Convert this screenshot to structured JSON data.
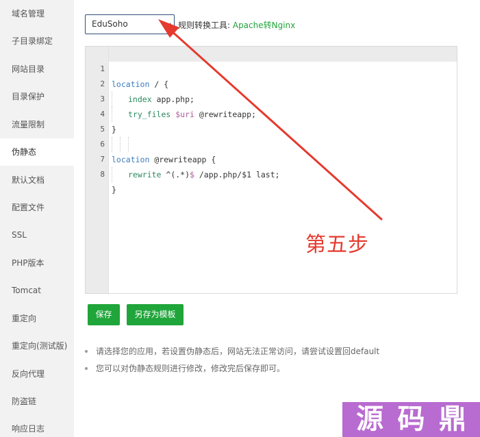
{
  "sidebar": {
    "items": [
      {
        "label": "域名管理"
      },
      {
        "label": "子目录绑定"
      },
      {
        "label": "网站目录"
      },
      {
        "label": "目录保护"
      },
      {
        "label": "流量限制"
      },
      {
        "label": "伪静态"
      },
      {
        "label": "默认文档"
      },
      {
        "label": "配置文件"
      },
      {
        "label": "SSL"
      },
      {
        "label": "PHP版本"
      },
      {
        "label": "Tomcat"
      },
      {
        "label": "重定向"
      },
      {
        "label": "重定向(测试版)"
      },
      {
        "label": "反向代理"
      },
      {
        "label": "防盗链"
      },
      {
        "label": "响应日志"
      }
    ],
    "active": "伪静态"
  },
  "preset": {
    "selected": "EduSoho"
  },
  "converter": {
    "label": "规则转换工具: ",
    "link": "Apache转Nginx"
  },
  "editor": {
    "line_numbers": [
      "1",
      "2",
      "3",
      "4",
      "5",
      "6",
      "7",
      "8"
    ],
    "lines": [
      "location / {",
      "    index app.php;",
      "    try_files $uri @rewriteapp;",
      "}",
      "",
      "location @rewriteapp {",
      "    rewrite ^(.*)$ /app.php/$1 last;",
      "}"
    ]
  },
  "buttons": {
    "save": "保存",
    "save_as_template": "另存为模板"
  },
  "tips": [
    "请选择您的应用，若设置伪静态后，网站无法正常访问，请尝试设置回default",
    "您可以对伪静态规则进行修改，修改完后保存即可。"
  ],
  "annotation": {
    "step_label": "第五步",
    "color": "#e53a2e"
  },
  "watermark": {
    "chars": [
      "源",
      "码",
      "鼎"
    ],
    "color": "#b86bd0"
  },
  "colors": {
    "accent_green": "#20a53a",
    "sidebar_bg": "#f2f2f2"
  }
}
